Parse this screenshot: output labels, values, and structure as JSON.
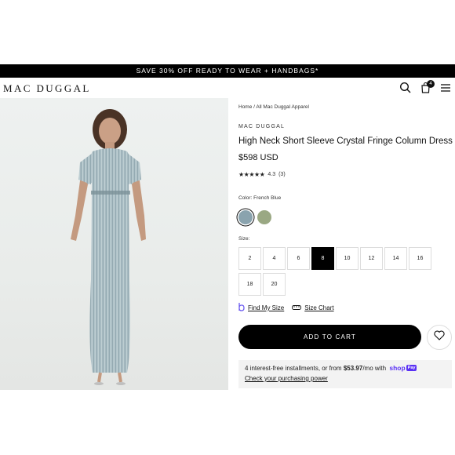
{
  "promo": {
    "text": "SAVE 30% OFF READY TO WEAR + HANDBAGS*"
  },
  "header": {
    "logo": "MAC DUGGAL",
    "cart_count": "4"
  },
  "product": {
    "breadcrumb": "Home / All Mac Duggal Apparel",
    "brand": "MAC DUGGAL",
    "title": "High Neck Short Sleeve Crystal Fringe Column Dress",
    "price": "$598 USD",
    "rating_value": "4.3",
    "rating_count": "(3)",
    "stars": "★★★★★",
    "color_label": "Color: French Blue",
    "swatches": [
      {
        "name": "French Blue",
        "color": "#8aa3ae",
        "selected": true
      },
      {
        "name": "Sage",
        "color": "#9aa883",
        "selected": false
      }
    ],
    "size_label": "Size:",
    "sizes": [
      "2",
      "4",
      "6",
      "8",
      "10",
      "12",
      "14",
      "16",
      "18",
      "20"
    ],
    "selected_size": "8",
    "find_my_size": "Find My Size",
    "size_chart": "Size Chart",
    "add_to_cart": "ADD TO CART",
    "shop_pay": {
      "text_before": "4 interest-free installments, or from",
      "amount": "$53.97",
      "text_after": "/mo with",
      "brand": "shop",
      "badge": "Pay",
      "link": "Check your purchasing power"
    }
  },
  "colors": {
    "accent": "#000000",
    "shop_pay": "#5a31f4"
  }
}
